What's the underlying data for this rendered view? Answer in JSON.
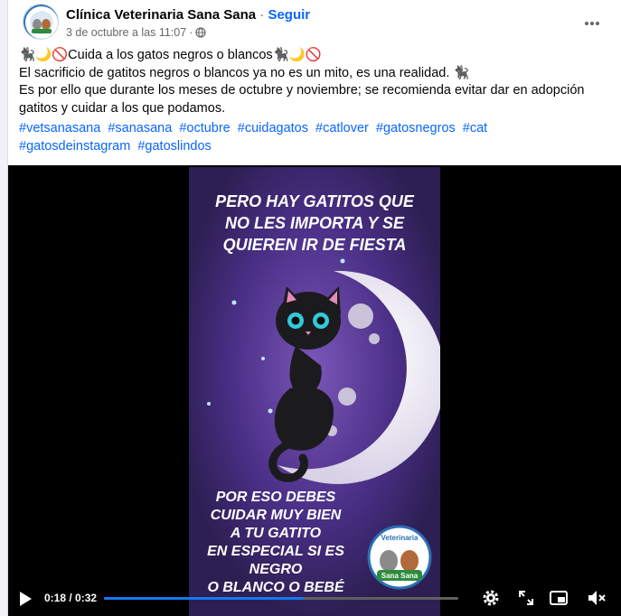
{
  "post": {
    "page_name": "Clínica Veterinaria Sana Sana",
    "separator": " · ",
    "follow_label": "Seguir",
    "date": "3 de octubre a las 11:07",
    "meta_dot": "·",
    "line1": "🐈‍⬛🌙🚫Cuida a los gatos negros o blancos🐈‍⬛🌙🚫",
    "line2": "El sacrificio de gatitos negros o blancos ya no es un mito, es una realidad. 🐈‍⬛",
    "line3": "Es por ello que durante los meses de octubre y noviembre; se recomienda evitar dar en adopción gatitos y cuidar a los que podamos.",
    "hashtags": [
      "#vetsanasana",
      "#sanasana",
      "#octubre",
      "#cuidagatos",
      "#catlover",
      "#gatosnegros",
      "#cat",
      "#gatosdeinstagram",
      "#gatoslindos"
    ]
  },
  "video": {
    "top_text": [
      "PERO HAY GATITOS QUE",
      "NO LES IMPORTA Y SE",
      "QUIEREN IR DE FIESTA"
    ],
    "bottom_text": [
      "POR ESO DEBES",
      "CUIDAR MUY BIEN",
      "A TU GATITO",
      "EN ESPECIAL SI ES",
      "NEGRO",
      "O BLANCO O BEBÉ"
    ],
    "logo_top": "Veterinaria",
    "logo_bottom": "Sana Sana",
    "current_time": "0:18",
    "total_time": "0:32",
    "time_display": "0:18 / 0:32",
    "progress": 0.5625
  },
  "colors": {
    "link": "#0866ff",
    "progress": "#1877f2",
    "video_bg": "#2d1f53"
  }
}
